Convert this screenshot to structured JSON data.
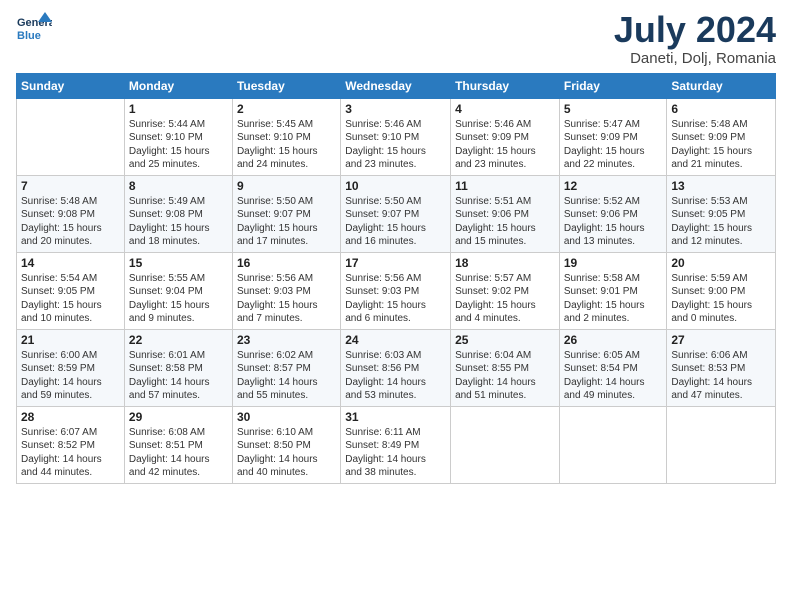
{
  "logo": {
    "line1": "General",
    "line2": "Blue"
  },
  "title": "July 2024",
  "subtitle": "Daneti, Dolj, Romania",
  "headers": [
    "Sunday",
    "Monday",
    "Tuesday",
    "Wednesday",
    "Thursday",
    "Friday",
    "Saturday"
  ],
  "weeks": [
    [
      {
        "day": "",
        "info": ""
      },
      {
        "day": "1",
        "info": "Sunrise: 5:44 AM\nSunset: 9:10 PM\nDaylight: 15 hours\nand 25 minutes."
      },
      {
        "day": "2",
        "info": "Sunrise: 5:45 AM\nSunset: 9:10 PM\nDaylight: 15 hours\nand 24 minutes."
      },
      {
        "day": "3",
        "info": "Sunrise: 5:46 AM\nSunset: 9:10 PM\nDaylight: 15 hours\nand 23 minutes."
      },
      {
        "day": "4",
        "info": "Sunrise: 5:46 AM\nSunset: 9:09 PM\nDaylight: 15 hours\nand 23 minutes."
      },
      {
        "day": "5",
        "info": "Sunrise: 5:47 AM\nSunset: 9:09 PM\nDaylight: 15 hours\nand 22 minutes."
      },
      {
        "day": "6",
        "info": "Sunrise: 5:48 AM\nSunset: 9:09 PM\nDaylight: 15 hours\nand 21 minutes."
      }
    ],
    [
      {
        "day": "7",
        "info": "Sunrise: 5:48 AM\nSunset: 9:08 PM\nDaylight: 15 hours\nand 20 minutes."
      },
      {
        "day": "8",
        "info": "Sunrise: 5:49 AM\nSunset: 9:08 PM\nDaylight: 15 hours\nand 18 minutes."
      },
      {
        "day": "9",
        "info": "Sunrise: 5:50 AM\nSunset: 9:07 PM\nDaylight: 15 hours\nand 17 minutes."
      },
      {
        "day": "10",
        "info": "Sunrise: 5:50 AM\nSunset: 9:07 PM\nDaylight: 15 hours\nand 16 minutes."
      },
      {
        "day": "11",
        "info": "Sunrise: 5:51 AM\nSunset: 9:06 PM\nDaylight: 15 hours\nand 15 minutes."
      },
      {
        "day": "12",
        "info": "Sunrise: 5:52 AM\nSunset: 9:06 PM\nDaylight: 15 hours\nand 13 minutes."
      },
      {
        "day": "13",
        "info": "Sunrise: 5:53 AM\nSunset: 9:05 PM\nDaylight: 15 hours\nand 12 minutes."
      }
    ],
    [
      {
        "day": "14",
        "info": "Sunrise: 5:54 AM\nSunset: 9:05 PM\nDaylight: 15 hours\nand 10 minutes."
      },
      {
        "day": "15",
        "info": "Sunrise: 5:55 AM\nSunset: 9:04 PM\nDaylight: 15 hours\nand 9 minutes."
      },
      {
        "day": "16",
        "info": "Sunrise: 5:56 AM\nSunset: 9:03 PM\nDaylight: 15 hours\nand 7 minutes."
      },
      {
        "day": "17",
        "info": "Sunrise: 5:56 AM\nSunset: 9:03 PM\nDaylight: 15 hours\nand 6 minutes."
      },
      {
        "day": "18",
        "info": "Sunrise: 5:57 AM\nSunset: 9:02 PM\nDaylight: 15 hours\nand 4 minutes."
      },
      {
        "day": "19",
        "info": "Sunrise: 5:58 AM\nSunset: 9:01 PM\nDaylight: 15 hours\nand 2 minutes."
      },
      {
        "day": "20",
        "info": "Sunrise: 5:59 AM\nSunset: 9:00 PM\nDaylight: 15 hours\nand 0 minutes."
      }
    ],
    [
      {
        "day": "21",
        "info": "Sunrise: 6:00 AM\nSunset: 8:59 PM\nDaylight: 14 hours\nand 59 minutes."
      },
      {
        "day": "22",
        "info": "Sunrise: 6:01 AM\nSunset: 8:58 PM\nDaylight: 14 hours\nand 57 minutes."
      },
      {
        "day": "23",
        "info": "Sunrise: 6:02 AM\nSunset: 8:57 PM\nDaylight: 14 hours\nand 55 minutes."
      },
      {
        "day": "24",
        "info": "Sunrise: 6:03 AM\nSunset: 8:56 PM\nDaylight: 14 hours\nand 53 minutes."
      },
      {
        "day": "25",
        "info": "Sunrise: 6:04 AM\nSunset: 8:55 PM\nDaylight: 14 hours\nand 51 minutes."
      },
      {
        "day": "26",
        "info": "Sunrise: 6:05 AM\nSunset: 8:54 PM\nDaylight: 14 hours\nand 49 minutes."
      },
      {
        "day": "27",
        "info": "Sunrise: 6:06 AM\nSunset: 8:53 PM\nDaylight: 14 hours\nand 47 minutes."
      }
    ],
    [
      {
        "day": "28",
        "info": "Sunrise: 6:07 AM\nSunset: 8:52 PM\nDaylight: 14 hours\nand 44 minutes."
      },
      {
        "day": "29",
        "info": "Sunrise: 6:08 AM\nSunset: 8:51 PM\nDaylight: 14 hours\nand 42 minutes."
      },
      {
        "day": "30",
        "info": "Sunrise: 6:10 AM\nSunset: 8:50 PM\nDaylight: 14 hours\nand 40 minutes."
      },
      {
        "day": "31",
        "info": "Sunrise: 6:11 AM\nSunset: 8:49 PM\nDaylight: 14 hours\nand 38 minutes."
      },
      {
        "day": "",
        "info": ""
      },
      {
        "day": "",
        "info": ""
      },
      {
        "day": "",
        "info": ""
      }
    ]
  ]
}
